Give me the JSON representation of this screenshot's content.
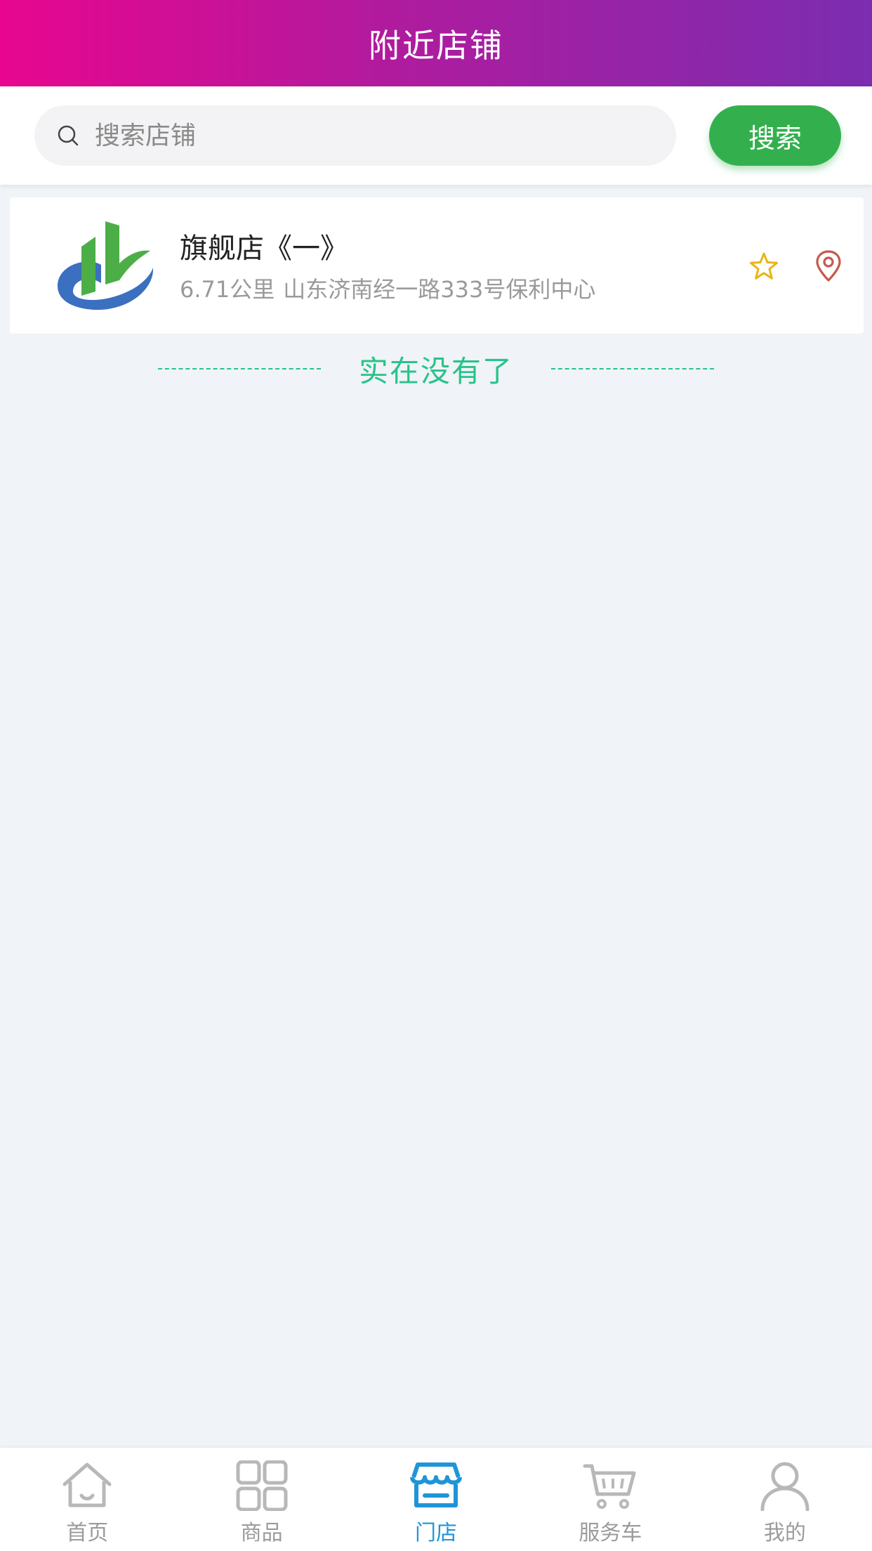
{
  "header": {
    "title": "附近店铺"
  },
  "search": {
    "placeholder": "搜索店铺",
    "button_label": "搜索"
  },
  "stores": [
    {
      "name": "旗舰店《一》",
      "distance": "6.71公里",
      "address": "山东济南经一路333号保利中心"
    }
  ],
  "end_text": "实在没有了",
  "tabs": [
    {
      "label": "首页",
      "icon": "home-icon"
    },
    {
      "label": "商品",
      "icon": "grid-icon"
    },
    {
      "label": "门店",
      "icon": "store-icon",
      "active": true
    },
    {
      "label": "服务车",
      "icon": "cart-icon"
    },
    {
      "label": "我的",
      "icon": "user-icon"
    }
  ],
  "colors": {
    "header_gradient_start": "#e8068f",
    "header_gradient_end": "#7b2db0",
    "search_button": "#33b04d",
    "end_text": "#27c48a",
    "tab_active": "#1f95d8",
    "tab_inactive": "#9b9b9b",
    "star": "#e8b514",
    "location_pin": "#c8574c"
  }
}
